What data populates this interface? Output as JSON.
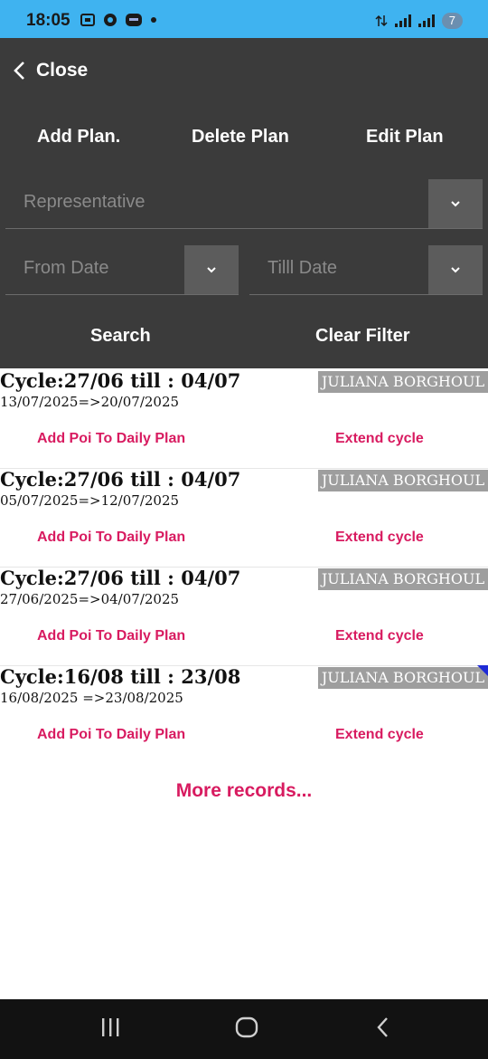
{
  "status_bar": {
    "time": "18:05",
    "battery": "7",
    "icons": [
      "screenshot-icon",
      "chrome-icon",
      "app-icon",
      "dot-icon",
      "data-arrows-icon",
      "signal-icon",
      "signal-icon-2",
      "battery-icon"
    ]
  },
  "header": {
    "close_label": "Close",
    "actions": {
      "add": "Add Plan.",
      "delete": "Delete Plan",
      "edit": "Edit Plan"
    }
  },
  "filters": {
    "representative_placeholder": "Representative",
    "from_placeholder": "From Date",
    "till_placeholder": "Tilll Date",
    "search_label": "Search",
    "clear_label": "Clear Filter"
  },
  "records": [
    {
      "title": "Cycle:27/06 till : 04/07",
      "range": "13/07/2025=>20/07/2025",
      "rep": "JULIANA BORGHOUL",
      "add_poi": "Add Poi To Daily Plan",
      "extend": "Extend cycle"
    },
    {
      "title": "Cycle:27/06 till : 04/07",
      "range": "05/07/2025=>12/07/2025",
      "rep": "JULIANA BORGHOUL",
      "add_poi": "Add Poi To Daily Plan",
      "extend": "Extend cycle"
    },
    {
      "title": "Cycle:27/06 till : 04/07",
      "range": "27/06/2025=>04/07/2025",
      "rep": "JULIANA BORGHOUL",
      "add_poi": "Add Poi To Daily Plan",
      "extend": "Extend cycle"
    },
    {
      "title": "Cycle:16/08 till : 23/08",
      "range": "16/08/2025 =>23/08/2025",
      "rep": "JULIANA BORGHOUL",
      "add_poi": "Add Poi To Daily Plan",
      "extend": "Extend cycle"
    }
  ],
  "more_label": "More records...",
  "colors": {
    "status_bar": "#3fb3f0",
    "panel": "#3b3b3b",
    "accent": "#d81b60",
    "badge": "#9e9e9e"
  },
  "nav_icons": [
    "recents-icon",
    "home-icon",
    "back-icon"
  ]
}
